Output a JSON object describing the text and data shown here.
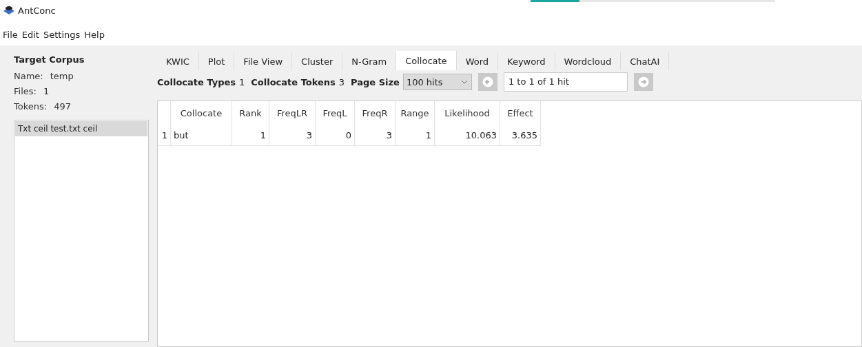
{
  "window": {
    "title": "AntConc"
  },
  "progress": {
    "level": 0.2
  },
  "menu": [
    "File",
    "Edit",
    "Settings",
    "Help"
  ],
  "sidebar": {
    "title": "Target Corpus",
    "fields": [
      {
        "label": "Name:",
        "value": "temp"
      },
      {
        "label": "Files:",
        "value": "1"
      },
      {
        "label": "Tokens:",
        "value": "497"
      }
    ],
    "files": [
      {
        "name": "Txt ceil test.txt ceil",
        "selected": true
      }
    ]
  },
  "tabs": [
    {
      "label": "KWIC",
      "selected": false
    },
    {
      "label": "Plot",
      "selected": false
    },
    {
      "label": "File View",
      "selected": false
    },
    {
      "label": "Cluster",
      "selected": false
    },
    {
      "label": "N-Gram",
      "selected": false
    },
    {
      "label": "Collocate",
      "selected": true
    },
    {
      "label": "Word",
      "selected": false
    },
    {
      "label": "Keyword",
      "selected": false
    },
    {
      "label": "Wordcloud",
      "selected": false
    },
    {
      "label": "ChatAI",
      "selected": false
    }
  ],
  "stats": [
    {
      "label": "Collocate Types",
      "value": "1"
    },
    {
      "label": "Collocate Tokens",
      "value": "3"
    }
  ],
  "page_size": {
    "label": "Page Size",
    "value": "100 hits"
  },
  "hits": "1 to 1 of 1 hit",
  "table": {
    "columns": [
      "Collocate",
      "Rank",
      "FreqLR",
      "FreqL",
      "FreqR",
      "Range",
      "Likelihood",
      "Effect"
    ],
    "rows": [
      {
        "index": "1",
        "cells": [
          "but",
          "1",
          "3",
          "0",
          "3",
          "1",
          "10.063",
          "3.635"
        ]
      }
    ]
  }
}
